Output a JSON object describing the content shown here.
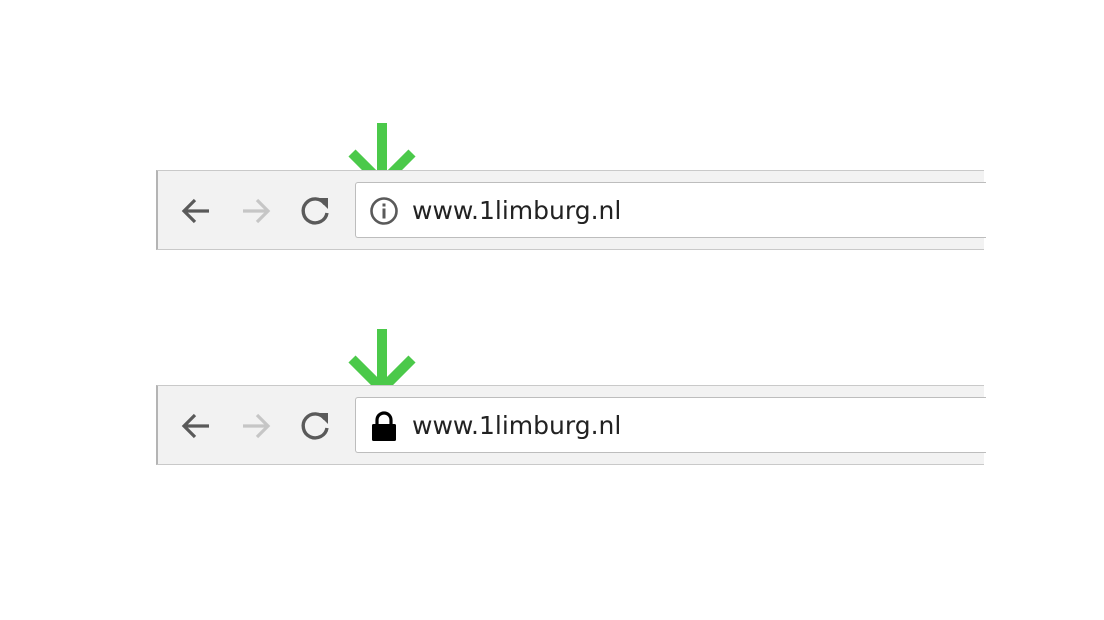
{
  "colors": {
    "arrow": "#4bc94a",
    "toolbar_bg": "#f2f2f2",
    "nav_icon": "#5a5a5a",
    "nav_icon_disabled": "#c6c6c6",
    "url_text": "#222222",
    "lock": "#000000"
  },
  "bars": [
    {
      "url": "www.1limburg.nl",
      "security_icon": "info-icon",
      "forward_enabled": false
    },
    {
      "url": "www.1limburg.nl",
      "security_icon": "lock-icon",
      "forward_enabled": false
    }
  ],
  "marker_icon": "arrow-down-icon"
}
